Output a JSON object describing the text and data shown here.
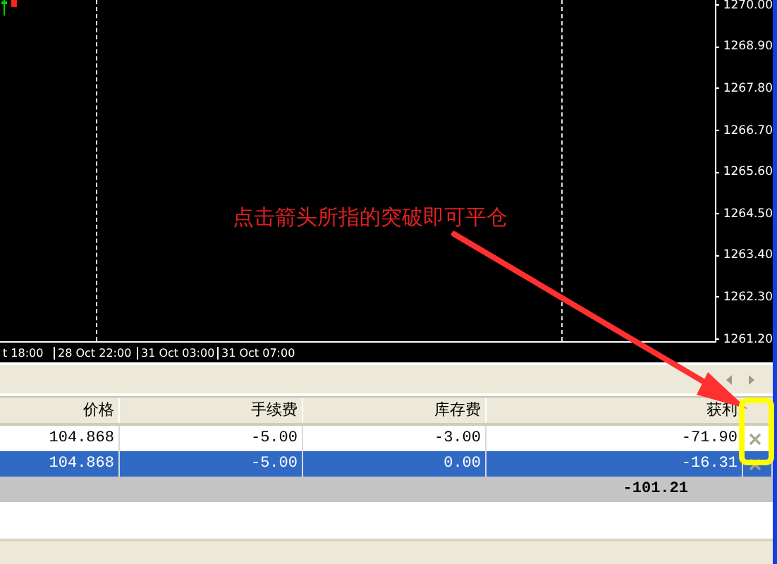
{
  "chart": {
    "price_labels": [
      "1270.00",
      "1268.90",
      "1267.80",
      "1266.70",
      "1265.60",
      "1264.50",
      "1263.40",
      "1262.30",
      "1261.20"
    ],
    "time_labels": [
      "t 18:00",
      "28 Oct 22:00",
      "31 Oct 03:00",
      "31 Oct 07:00"
    ],
    "annotation": "点击箭头所指的突破即可平仓"
  },
  "positions": {
    "columns": [
      "价格",
      "手续费",
      "库存费",
      "获利"
    ],
    "rows": [
      {
        "cells": [
          "104.868",
          "-5.00",
          "-3.00",
          "-71.90"
        ],
        "selected": false
      },
      {
        "cells": [
          "104.868",
          "-5.00",
          "0.00",
          "-16.31"
        ],
        "selected": true
      }
    ],
    "total": "-101.21"
  }
}
